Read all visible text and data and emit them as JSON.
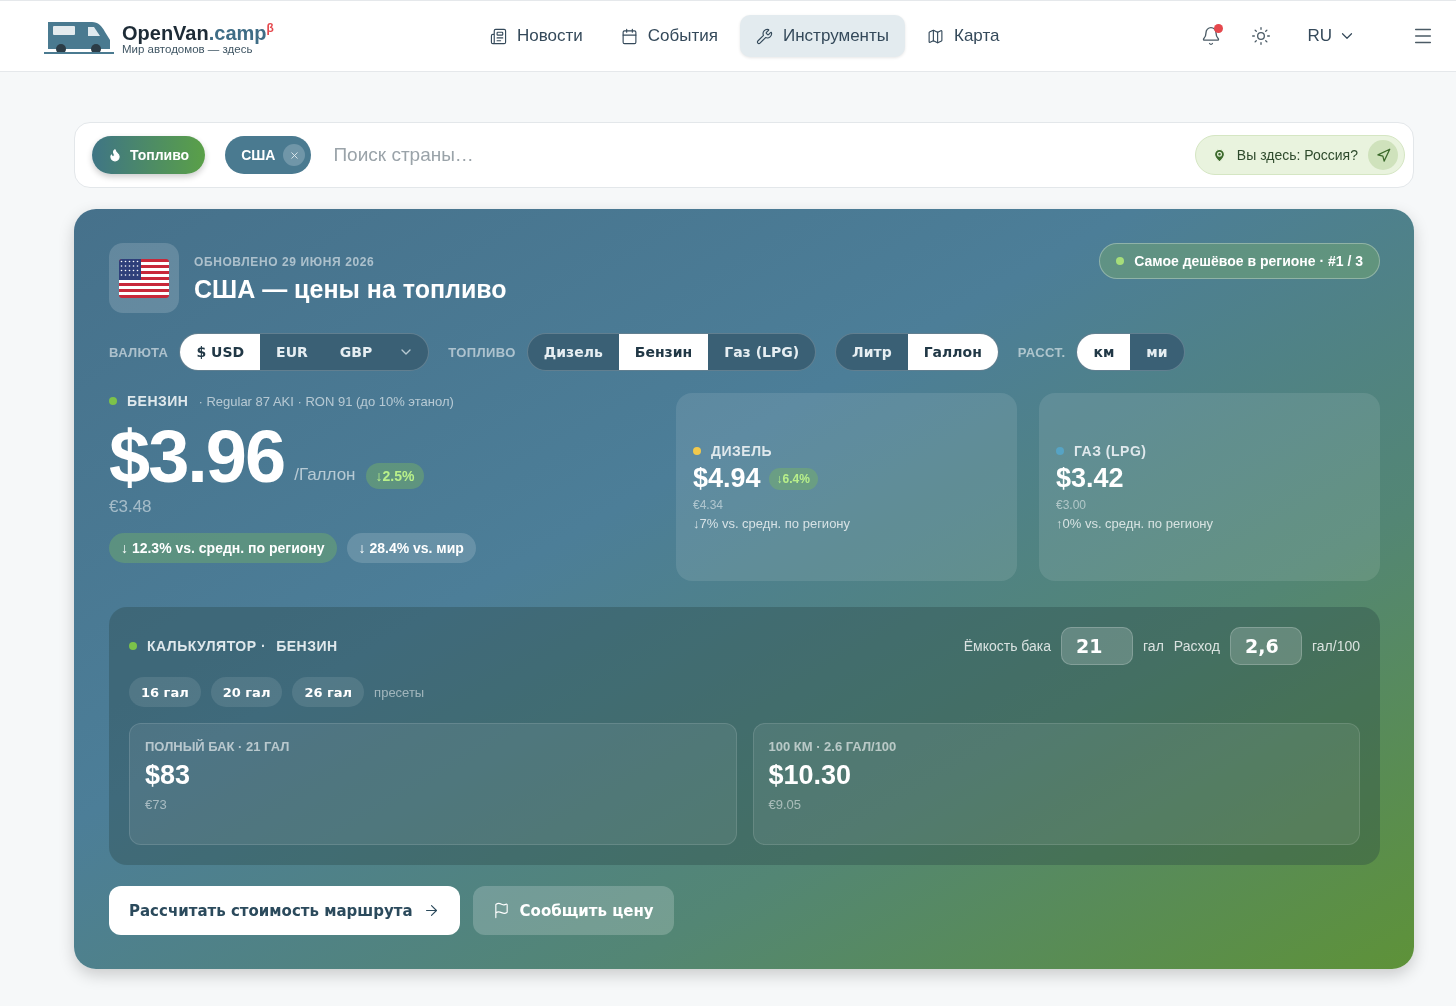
{
  "header": {
    "logo": {
      "name": "OpenVan",
      "suffix": ".camp",
      "beta": "β",
      "tagline": "Мир автодомов — здесь"
    },
    "nav": [
      {
        "label": "Новости",
        "selected": false
      },
      {
        "label": "События",
        "selected": false
      },
      {
        "label": "Инструменты",
        "selected": true
      },
      {
        "label": "Карта",
        "selected": false
      }
    ],
    "notifications": {
      "unread": true
    },
    "language": "RU"
  },
  "search": {
    "category": "Топливо",
    "country": "США",
    "placeholder": "Поиск страны…",
    "location_prompt": "Вы здесь: Россия?"
  },
  "card": {
    "updated": "ОБНОВЛЕНО 29 ИЮНЯ 2026",
    "title": "США — цены на топливо",
    "rank_badge": "Самое дешёвое в регионе · #1 / 3",
    "toggles": [
      {
        "label": "ВАЛЮТА",
        "dropdown": true,
        "options": [
          {
            "label": "$ USD",
            "selected": true
          },
          {
            "label": "EUR",
            "selected": false
          },
          {
            "label": "GBP",
            "selected": false
          }
        ]
      },
      {
        "label": "ТОПЛИВО",
        "options": [
          {
            "label": "Дизель",
            "selected": false
          },
          {
            "label": "Бензин",
            "selected": true
          },
          {
            "label": "Газ (LPG)",
            "selected": false
          }
        ]
      },
      {
        "options": [
          {
            "label": "Литр",
            "selected": false
          },
          {
            "label": "Галлон",
            "selected": true
          }
        ]
      },
      {
        "label": "РАССТ.",
        "options": [
          {
            "label": "км",
            "selected": true
          },
          {
            "label": "ми",
            "selected": false
          }
        ]
      }
    ],
    "main_fuel": {
      "name": "БЕНЗИН",
      "color": "#7cc24a",
      "spec": "· Regular 87 AKI · RON 91 (до 10% этанол)",
      "price": "$3.96",
      "unit": "/Галлон",
      "change": "↓2.5%",
      "secondary": "€3.48",
      "comparisons": [
        {
          "text": "↓ 12.3% vs. средн. по региону",
          "kind": "good"
        },
        {
          "text": "↓ 28.4% vs. мир",
          "kind": "neutral"
        }
      ]
    },
    "other_fuels": [
      {
        "name": "ДИЗЕЛЬ",
        "color": "#f2c94c",
        "price": "$4.94",
        "change": "↓6.4%",
        "secondary": "€4.34",
        "comparison": "↓7% vs. средн. по региону"
      },
      {
        "name": "ГАЗ (LPG)",
        "color": "#56a3c4",
        "price": "$3.42",
        "secondary": "€3.00",
        "comparison": "↑0% vs. средн. по региону"
      }
    ],
    "calculator": {
      "title": "КАЛЬКУЛЯТОР ·",
      "fuel": "БЕНЗИН",
      "color": "#7cc24a",
      "fields": [
        {
          "label": "Ёмкость бака",
          "value": "21",
          "unit": "гал"
        },
        {
          "label": "Расход",
          "value": "2,6",
          "unit": "гал/100"
        }
      ],
      "presets": [
        "16 гал",
        "20 гал",
        "26 гал"
      ],
      "presets_label": "пресеты",
      "results": [
        {
          "title": "ПОЛНЫЙ БАК · 21 ГАЛ",
          "value": "$83",
          "secondary": "€73"
        },
        {
          "title": "100 КМ · 2.6 ГАЛ/100",
          "value": "$10.30",
          "secondary": "€9.05"
        }
      ]
    },
    "buttons": [
      {
        "label": "Рассчитать стоимость маршрута",
        "kind": "primary"
      },
      {
        "label": "Сообщить цену",
        "kind": "secondary"
      }
    ]
  }
}
